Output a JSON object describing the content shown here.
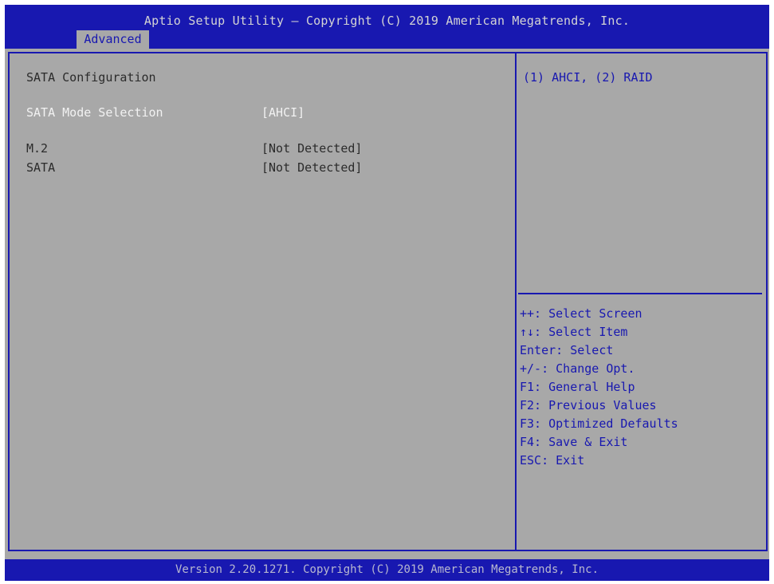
{
  "header": {
    "title": "Aptio Setup Utility – Copyright (C) 2019 American Megatrends, Inc.",
    "tab_label": "Advanced"
  },
  "main": {
    "section_title": "SATA Configuration",
    "rows": [
      {
        "label": "SATA Mode Selection",
        "value": "[AHCI]"
      },
      {
        "label": "M.2",
        "value": "[Not Detected]"
      },
      {
        "label": "SATA",
        "value": "[Not Detected]"
      }
    ]
  },
  "help": {
    "text": "(1) AHCI, (2) RAID"
  },
  "keys": [
    "++: Select Screen",
    "↑↓: Select Item",
    "Enter: Select",
    "+/-: Change Opt.",
    "F1: General Help",
    "F2: Previous Values",
    "F3: Optimized Defaults",
    "F4: Save & Exit",
    "ESC: Exit"
  ],
  "footer": {
    "text": "Version 2.20.1271. Copyright (C) 2019 American Megatrends, Inc."
  },
  "colors": {
    "bios_blue": "#1818b0",
    "panel_gray": "#a8a8a8",
    "highlight_white": "#f2f2f2"
  }
}
